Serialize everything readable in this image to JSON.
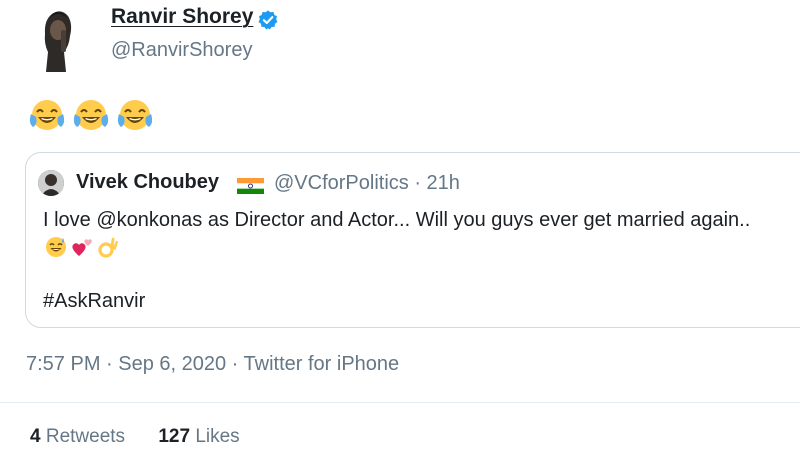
{
  "tweet": {
    "author_name": "Ranvir Shorey",
    "author_handle": "@RanvirShorey",
    "verified": true,
    "emojis": [
      "face-with-tears-of-joy-emoji",
      "face-with-tears-of-joy-emoji",
      "face-with-tears-of-joy-emoji"
    ],
    "timestamp": "7:57 PM · Sep 6, 2020 · Twitter for iPhone"
  },
  "quoted_tweet": {
    "author_name": "Vivek Choubey",
    "author_handle_time": "@VCforPolitics · 21h",
    "flag_icon": "india-flag-icon",
    "text": "I love @konkonas as Director and Actor... Will you guys ever get married again..",
    "emojis": [
      "grinning-sweat-emoji",
      "two-hearts-emoji",
      "ok-hand-emoji"
    ],
    "hashtag": "#AskRanvir"
  },
  "stats": {
    "retweets_count": "4",
    "retweets_label": "Retweets",
    "likes_count": "127",
    "likes_label": "Likes"
  },
  "colors": {
    "verified_blue": "#1d9bf0",
    "secondary_text": "#657786",
    "border": "#cfd9de"
  }
}
